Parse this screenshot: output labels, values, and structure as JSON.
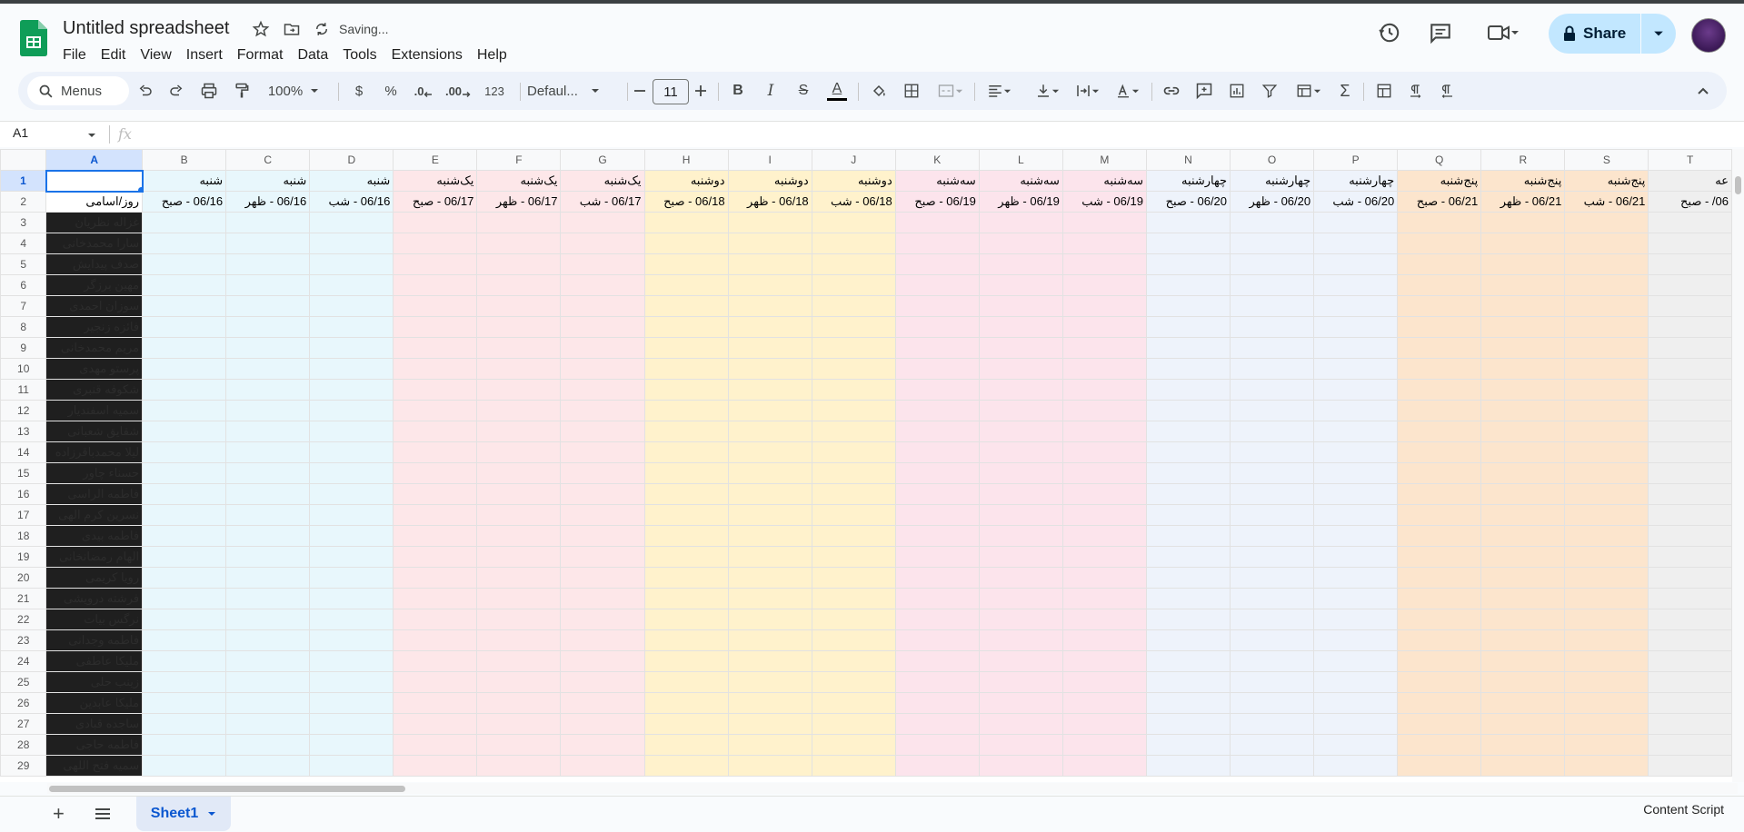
{
  "document": {
    "title": "Untitled spreadsheet",
    "status": "Saving..."
  },
  "menu": [
    "File",
    "Edit",
    "View",
    "Insert",
    "Format",
    "Data",
    "Tools",
    "Extensions",
    "Help"
  ],
  "share": {
    "label": "Share"
  },
  "toolbar": {
    "search_label": "Menus",
    "zoom": "100%",
    "currency": "$",
    "percent": "%",
    "decrease_decimal": ".0",
    "increase_decimal": ".00",
    "number_format": "123",
    "font": "Defaul...",
    "font_size": "11",
    "bold": "B",
    "italic": "I",
    "strikethrough": "S",
    "text_color": "A"
  },
  "formula_bar": {
    "name_box": "A1",
    "fx": "fx"
  },
  "columns": [
    "A",
    "B",
    "C",
    "D",
    "E",
    "F",
    "G",
    "H",
    "I",
    "J",
    "K",
    "L",
    "M",
    "N",
    "O",
    "P",
    "Q",
    "R",
    "S",
    "T"
  ],
  "column_colors": {
    "B": "#e8f7fc",
    "C": "#e8f7fc",
    "D": "#e8f7fc",
    "E": "#fde7e9",
    "F": "#fde7e9",
    "G": "#fde7e9",
    "H": "#fff2cc",
    "I": "#fff2cc",
    "J": "#fff2cc",
    "K": "#fce4ec",
    "L": "#fce4ec",
    "M": "#fce4ec",
    "N": "#eef3fb",
    "O": "#eef3fb",
    "P": "#eef3fb",
    "Q": "#fce5cd",
    "R": "#fce5cd",
    "S": "#fce5cd",
    "T": "#efefef"
  },
  "row1": [
    "",
    "شنبه",
    "شنبه",
    "شنبه",
    "یک‌شنبه",
    "یک‌شنبه",
    "یک‌شنبه",
    "دوشنبه",
    "دوشنبه",
    "دوشنبه",
    "سه‌شنبه",
    "سه‌شنبه",
    "سه‌شنبه",
    "چهارشنبه",
    "چهارشنبه",
    "چهارشنبه",
    "پنج‌شنبه",
    "پنج‌شنبه",
    "پنج‌شنبه",
    "عه"
  ],
  "row2": [
    "روز/اسامی",
    "06/16 - صبح",
    "06/16 - ظهر",
    "06/16 - شب",
    "06/17 - صبح",
    "06/17 - ظهر",
    "06/17 - شب",
    "06/18 - صبح",
    "06/18 - ظهر",
    "06/18 - شب",
    "06/19 - صبح",
    "06/19 - ظهر",
    "06/19 - شب",
    "06/20 - صبح",
    "06/20 - ظهر",
    "06/20 - شب",
    "06/21 - صبح",
    "06/21 - ظهر",
    "06/21 - شب",
    "06/ - صبح"
  ],
  "names": [
    "غزاله نظریان",
    "سارا محمدخانی",
    "صدف پیدایش",
    "مهین برزگر",
    "سوزان احمدی",
    "فائزه زنجیر",
    "مریم محمدخانی",
    "پرستو مهدی",
    "شکوفه قنبری",
    "سمیه اسفندیار",
    "شقایق شعبانی",
    "لیلا محمدباقرزاده",
    "حسناء چاور",
    "فاطمه الراسی",
    "نسرین کرم الهی",
    "فاطمه بیدی",
    "الهام رمضانخانی",
    "رویا کریمی",
    "فرشته درویشی",
    "نرگس بیات",
    "فاطمه وجدانی",
    "ملیکا عاطفی",
    "زینب حلی",
    "ملیکا عابدین",
    "ساجده قبادی",
    "فاطمه حاجی",
    "سمیه فتح اللهی"
  ],
  "sheet_tab": "Sheet1",
  "bottom_right": "Content Script"
}
